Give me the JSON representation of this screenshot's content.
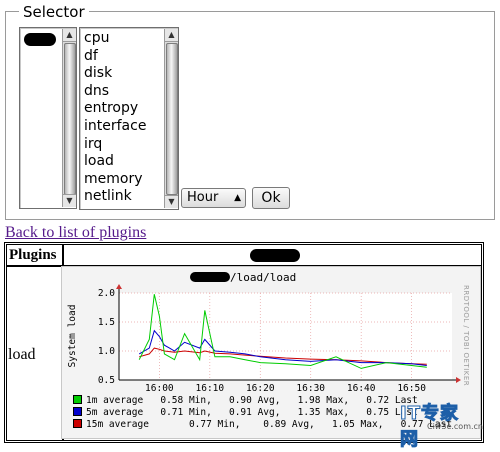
{
  "fieldset": {
    "legend": "Selector"
  },
  "host_list": {
    "selected_redacted": true
  },
  "plugin_list": {
    "items": [
      "cpu",
      "df",
      "disk",
      "dns",
      "entropy",
      "interface",
      "irq",
      "load",
      "memory",
      "netlink"
    ],
    "selected": "load"
  },
  "timespan": {
    "value": "Hour"
  },
  "ok_label": "Ok",
  "back_link": "Back to list of plugins",
  "table": {
    "header_left": "Plugins",
    "row_label": "load"
  },
  "graph": {
    "title_suffix": "/load/load",
    "side_label": "RRDTOOL / TOBI OETIKER",
    "legend": [
      {
        "swatch": "#00cc00",
        "text": "1m average   0.58 Min,   0.90 Avg,   1.98 Max,   0.72 Last"
      },
      {
        "swatch": "#0000cc",
        "text": "5m average   0.71 Min,   0.91 Avg,   1.35 Max,   0.75 Last"
      },
      {
        "swatch": "#cc0000",
        "text": "15m average       0.77 Min,    0.89 Avg,   1.05 Max,   0.77 Last"
      }
    ],
    "watermark": {
      "brand": "IT专家网",
      "site": "Ciw3e.com.cn"
    }
  },
  "chart_data": {
    "type": "line",
    "ylabel": "System load",
    "x_ticks": [
      "16:00",
      "16:10",
      "16:20",
      "16:30",
      "16:40",
      "16:50"
    ],
    "y_ticks": [
      "0.5",
      "1.0",
      "1.5",
      "2.0"
    ],
    "ylim": [
      0.5,
      2.0
    ],
    "x": [
      -4,
      -2,
      -1,
      0,
      1,
      2,
      3,
      5,
      8,
      9,
      11,
      14,
      17,
      20,
      25,
      30,
      35,
      40,
      45,
      50,
      53
    ],
    "series": [
      {
        "name": "1m average",
        "color": "#00cc00",
        "values": [
          0.85,
          1.2,
          1.98,
          1.6,
          0.95,
          0.9,
          0.85,
          1.3,
          0.85,
          1.7,
          0.9,
          0.9,
          0.85,
          0.8,
          0.78,
          0.75,
          0.9,
          0.7,
          0.8,
          0.75,
          0.72
        ]
      },
      {
        "name": "5m average",
        "color": "#0000cc",
        "values": [
          0.95,
          1.05,
          1.35,
          1.25,
          1.1,
          1.05,
          1.0,
          1.15,
          1.05,
          1.2,
          1.0,
          0.98,
          0.95,
          0.9,
          0.85,
          0.82,
          0.85,
          0.8,
          0.8,
          0.78,
          0.75
        ]
      },
      {
        "name": "15m average",
        "color": "#cc0000",
        "values": [
          0.9,
          0.95,
          1.05,
          1.03,
          1.0,
          0.99,
          0.98,
          1.0,
          0.97,
          1.0,
          0.96,
          0.95,
          0.93,
          0.91,
          0.88,
          0.86,
          0.85,
          0.83,
          0.8,
          0.78,
          0.77
        ]
      }
    ],
    "grid": true
  }
}
